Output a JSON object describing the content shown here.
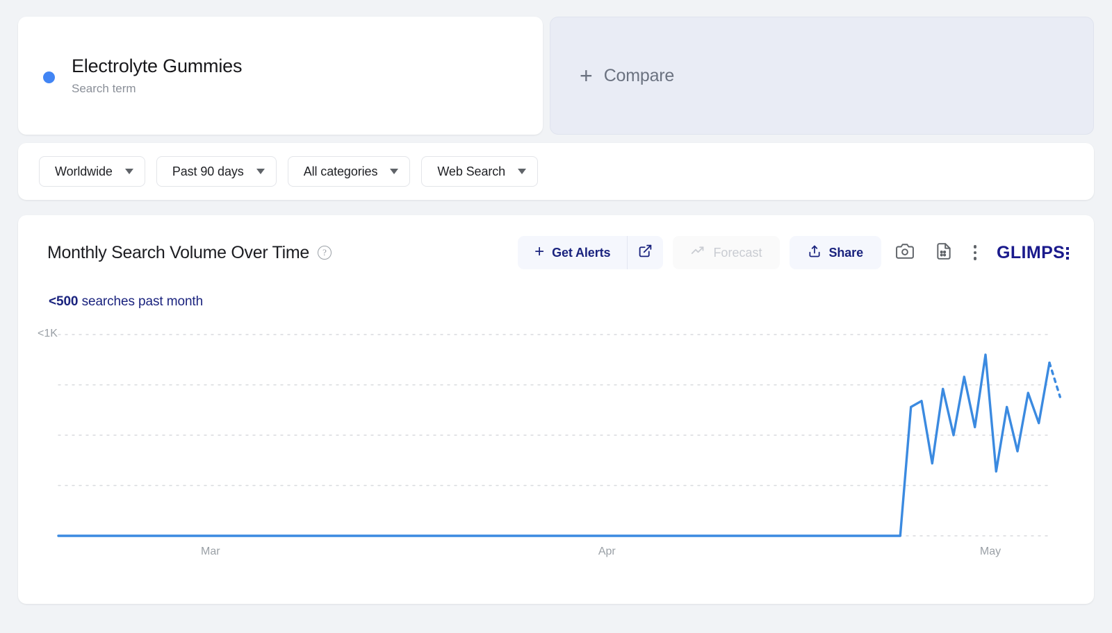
{
  "term": {
    "name": "Electrolyte Gummies",
    "subtitle": "Search term",
    "dot_color": "#4285f4"
  },
  "compare": {
    "plus": "+",
    "label": "Compare"
  },
  "filters": [
    {
      "label": "Worldwide",
      "name": "location"
    },
    {
      "label": "Past 90 days",
      "name": "timerange"
    },
    {
      "label": "All categories",
      "name": "category"
    },
    {
      "label": "Web Search",
      "name": "searchtype"
    }
  ],
  "chart_card": {
    "title": "Monthly Search Volume Over Time",
    "help_glyph": "?",
    "volume_value": "<500",
    "volume_suffix": " searches past month",
    "toolbar": {
      "alerts_label": "Get Alerts",
      "alerts_plus": "+",
      "open_icon": "external-link-icon",
      "forecast_label": "Forecast",
      "forecast_disabled": true,
      "share_label": "Share",
      "camera_icon": "camera-icon",
      "csv_icon": "document-icon",
      "kebab_icon": "more-vertical-icon"
    },
    "brand": "GLIMPS"
  },
  "chart_data": {
    "type": "line",
    "title": "Monthly Search Volume Over Time",
    "xlabel": "",
    "ylabel": "",
    "ylim": [
      0,
      1000
    ],
    "ytick_labels": [
      "<1K"
    ],
    "grid": true,
    "legend": false,
    "line_color": "#3b8ae0",
    "x_tick_labels": [
      "Mar",
      "Apr",
      "May"
    ],
    "x_tick_positions": [
      0.155,
      0.556,
      0.941
    ],
    "note": "Flat at zero until early May, then sharp spike with volatile oscillation; final segment dashed (partial period).",
    "series": [
      {
        "name": "Electrolyte Gummies",
        "values": [
          0,
          0,
          0,
          0,
          0,
          0,
          0,
          0,
          0,
          0,
          0,
          0,
          0,
          0,
          0,
          0,
          0,
          0,
          0,
          0,
          0,
          0,
          0,
          0,
          0,
          0,
          0,
          0,
          0,
          0,
          0,
          0,
          0,
          0,
          0,
          0,
          0,
          0,
          0,
          0,
          0,
          0,
          0,
          0,
          0,
          0,
          0,
          0,
          0,
          0,
          0,
          0,
          0,
          0,
          0,
          0,
          0,
          0,
          0,
          0,
          0,
          0,
          0,
          0,
          0,
          0,
          0,
          0,
          0,
          0,
          0,
          0,
          0,
          0,
          0,
          0,
          0,
          0,
          0,
          0,
          640,
          670,
          360,
          730,
          500,
          790,
          540,
          900,
          320,
          640,
          420,
          710,
          560,
          860
        ],
        "dashed_tail_values": [
          860,
          690
        ]
      }
    ]
  }
}
